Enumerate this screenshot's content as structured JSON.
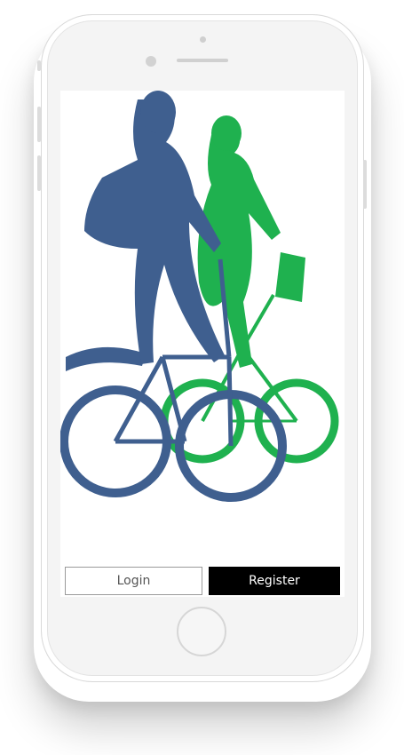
{
  "device": {
    "frame_color": "#f4f4f4"
  },
  "illustration": {
    "description": "two-cyclists-silhouette",
    "colors": {
      "front_rider": "#3f5f8f",
      "back_rider": "#1fb14f"
    }
  },
  "auth": {
    "login_label": "Login",
    "register_label": "Register"
  }
}
